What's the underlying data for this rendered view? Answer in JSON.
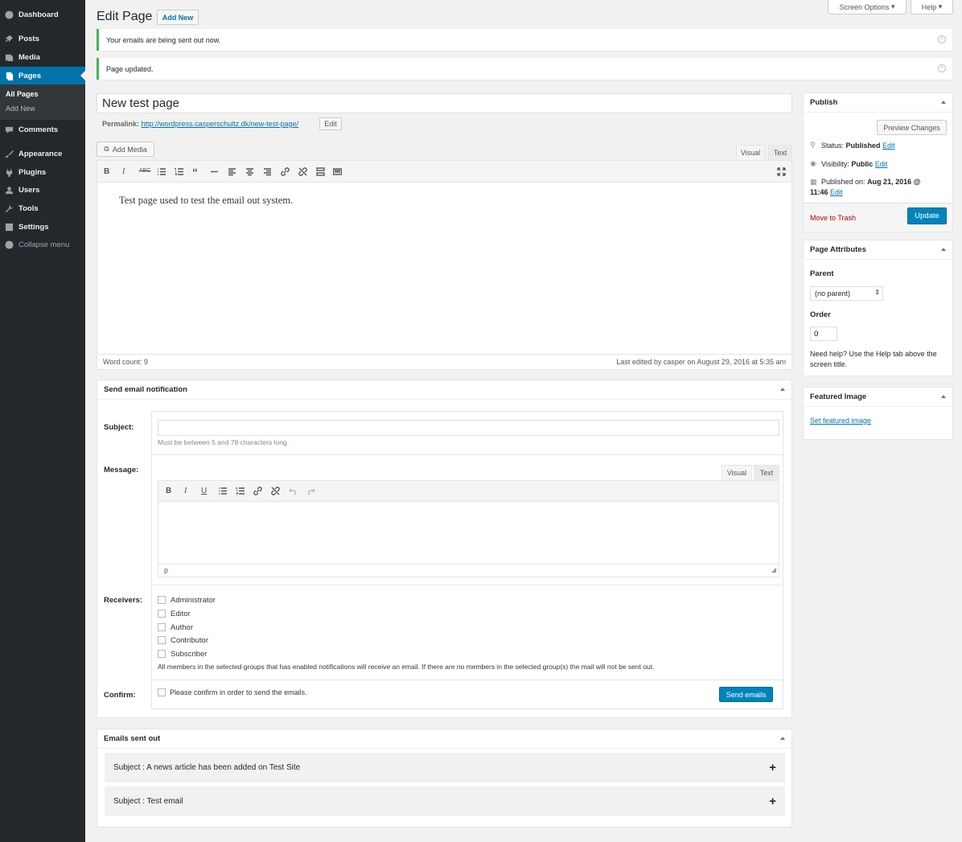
{
  "sidebar": {
    "items": [
      {
        "label": "Dashboard",
        "icon": "dashboard-icon"
      },
      {
        "label": "Posts",
        "icon": "pin-icon"
      },
      {
        "label": "Media",
        "icon": "media-icon"
      },
      {
        "label": "Pages",
        "icon": "pages-icon"
      },
      {
        "label": "Comments",
        "icon": "comment-icon"
      },
      {
        "label": "Appearance",
        "icon": "brush-icon"
      },
      {
        "label": "Plugins",
        "icon": "plugin-icon"
      },
      {
        "label": "Users",
        "icon": "users-icon"
      },
      {
        "label": "Tools",
        "icon": "wrench-icon"
      },
      {
        "label": "Settings",
        "icon": "settings-icon"
      },
      {
        "label": "Collapse menu",
        "icon": "collapse-icon"
      }
    ],
    "submenu": [
      "All Pages",
      "Add New"
    ]
  },
  "header": {
    "title": "Edit Page",
    "add_new": "Add New",
    "screen_options": "Screen Options",
    "help": "Help"
  },
  "notices": [
    "Your emails are being sent out now.",
    "Page updated."
  ],
  "editor": {
    "title_value": "New test page",
    "permalink_label": "Permalink:",
    "permalink_url": "http://wordpress.casperschultz.dk/new-test-page/",
    "permalink_edit": "Edit",
    "add_media": "Add Media",
    "tab_visual": "Visual",
    "tab_text": "Text",
    "content": "Test page used to test the email out system.",
    "word_count": "Word count: 9",
    "last_edited": "Last edited by casper on August 29, 2016 at 5:35 am"
  },
  "email_box": {
    "title": "Send email notification",
    "subject_label": "Subject:",
    "subject_value": "",
    "subject_hint": "Must be between 5 and 78 characters long.",
    "message_label": "Message:",
    "tab_visual": "Visual",
    "tab_text": "Text",
    "path": "p",
    "receivers_label": "Receivers:",
    "receivers": [
      "Administrator",
      "Editor",
      "Author",
      "Contributor",
      "Subscriber"
    ],
    "receivers_note": "All members in the selected groups that has enabled notifications will receive an email. If there are no members in the selected group(s) the mail will not be sent out.",
    "confirm_label": "Confirm:",
    "confirm_text": "Please confirm in order to send the emails.",
    "send_button": "Send emails"
  },
  "sent_box": {
    "title": "Emails sent out",
    "items": [
      "Subject : A news article has been added on Test Site",
      "Subject : Test email"
    ]
  },
  "publish": {
    "title": "Publish",
    "preview": "Preview Changes",
    "status_label": "Status:",
    "status_value": "Published",
    "visibility_label": "Visibility:",
    "visibility_value": "Public",
    "published_label": "Published on:",
    "published_date": "Aug 21, 2016 @",
    "published_time": "11:46",
    "edit": "Edit",
    "trash": "Move to Trash",
    "update": "Update"
  },
  "attributes": {
    "title": "Page Attributes",
    "parent_label": "Parent",
    "parent_value": "(no parent)",
    "order_label": "Order",
    "order_value": "0",
    "help_line1": "Need help? Use the Help tab above the",
    "help_line2": "screen title."
  },
  "featured": {
    "title": "Featured Image",
    "link": "Set featured image"
  },
  "colors": {
    "accent": "#0073aa",
    "primary_button": "#0085ba",
    "sidebar": "#23282d",
    "notice_success": "#46b450",
    "trash": "#a00"
  }
}
